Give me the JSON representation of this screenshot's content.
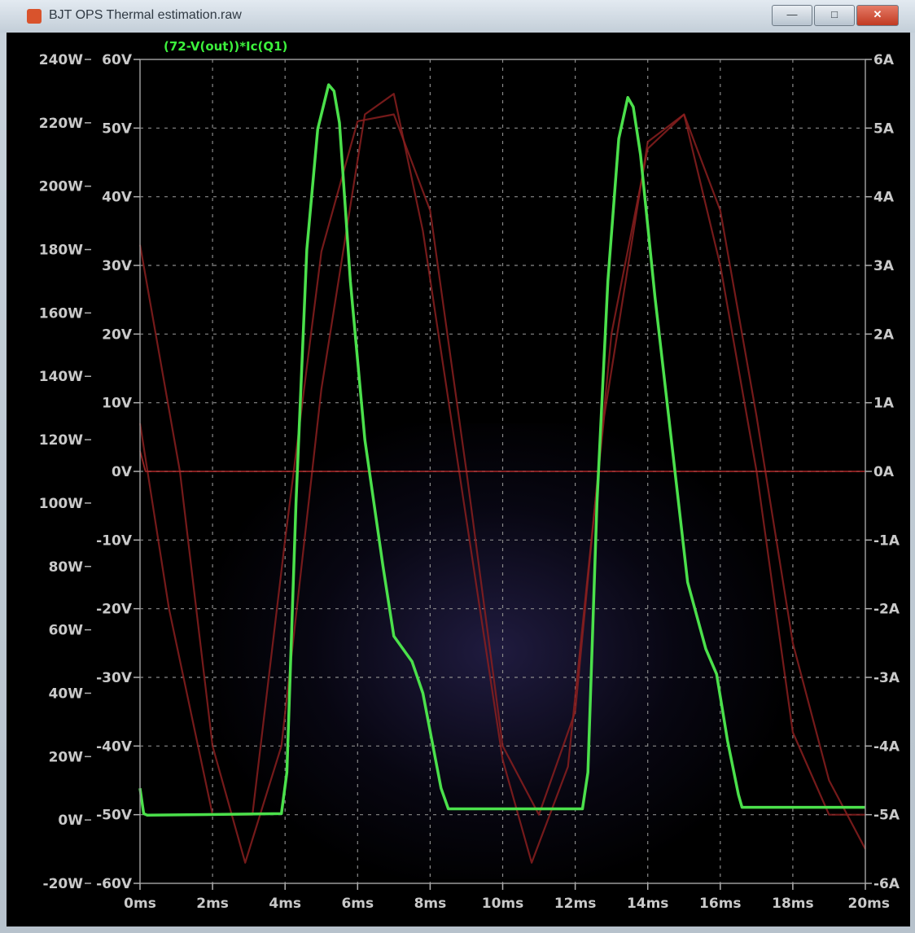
{
  "window": {
    "title": "BJT OPS Thermal estimation.raw",
    "minimize_label": "—",
    "maximize_label": "□",
    "close_label": "✕"
  },
  "chart_data": {
    "type": "line",
    "title": "(72-V(out))*Ic(Q1)",
    "colors": {
      "power": "#4be04b",
      "waveform": "#8a1e1e",
      "grid": "#8a8a8a",
      "zero_line": "#b02a2a"
    },
    "x_axis": {
      "unit": "ms",
      "range": [
        0,
        20
      ],
      "ticks": [
        0,
        2,
        4,
        6,
        8,
        10,
        12,
        14,
        16,
        18,
        20
      ],
      "tick_labels": [
        "0ms",
        "2ms",
        "4ms",
        "6ms",
        "8ms",
        "10ms",
        "12ms",
        "14ms",
        "16ms",
        "18ms",
        "20ms"
      ]
    },
    "y_axis_power": {
      "range": [
        -20,
        240
      ],
      "ticks": [
        -20,
        0,
        20,
        40,
        60,
        80,
        100,
        120,
        140,
        160,
        180,
        200,
        220,
        240
      ],
      "tick_labels": [
        "-20W",
        "0W",
        "20W",
        "40W",
        "60W",
        "80W",
        "100W",
        "120W",
        "140W",
        "160W",
        "180W",
        "200W",
        "220W",
        "240W"
      ]
    },
    "y_axis_voltage": {
      "range": [
        -60,
        60
      ],
      "ticks": [
        -60,
        -50,
        -40,
        -30,
        -20,
        -10,
        0,
        10,
        20,
        30,
        40,
        50,
        60
      ],
      "tick_labels": [
        "-60V",
        "-50V",
        "-40V",
        "-30V",
        "-20V",
        "-10V",
        "0V",
        "10V",
        "20V",
        "30V",
        "40V",
        "50V",
        "60V"
      ]
    },
    "y_axis_current": {
      "range": [
        -6,
        6
      ],
      "ticks": [
        -6,
        -5,
        -4,
        -3,
        -2,
        -1,
        0,
        1,
        2,
        3,
        4,
        5,
        6
      ],
      "tick_labels": [
        "-6A",
        "-5A",
        "-4A",
        "-3A",
        "-2A",
        "-1A",
        "0A",
        "1A",
        "2A",
        "3A",
        "4A",
        "5A",
        "6A"
      ]
    },
    "grid": true,
    "series": [
      {
        "name": "(72-V(out))*Ic(Q1)",
        "axis": "power",
        "x": [
          0,
          0.1,
          0.2,
          3.9,
          4.05,
          4.3,
          4.6,
          4.9,
          5.2,
          5.35,
          5.5,
          5.8,
          6.2,
          6.7,
          7.0,
          7.5,
          7.8,
          8.0,
          8.3,
          8.5,
          12.2,
          12.35,
          12.6,
          12.9,
          13.2,
          13.45,
          13.6,
          13.8,
          14.2,
          14.7,
          15.1,
          15.6,
          15.9,
          16.2,
          16.5,
          16.6,
          20
        ],
        "y": [
          10,
          2,
          1.5,
          2,
          15,
          100,
          180,
          218,
          232,
          230,
          220,
          170,
          120,
          80,
          58,
          50,
          40,
          28,
          10,
          3.5,
          3.5,
          15,
          100,
          170,
          215,
          228,
          225,
          210,
          165,
          115,
          75,
          54,
          46,
          25,
          8,
          4,
          4
        ]
      },
      {
        "axis": "voltage",
        "x": [
          0,
          1.1,
          2.0,
          2.9,
          3.9,
          5.0,
          6.2,
          7.0,
          7.8,
          8.8,
          10.0,
          10.8,
          11.8,
          12.8,
          14.0,
          15.0,
          16.0,
          17.0,
          18.0,
          19.0,
          20
        ],
        "y": [
          33,
          0,
          -40,
          -57,
          -40,
          12,
          52,
          55,
          35,
          0,
          -42,
          -57,
          -43,
          8,
          48,
          52,
          38,
          8,
          -25,
          -45,
          -55
        ]
      },
      {
        "axis": "voltage",
        "x": [
          0,
          0.8,
          2.0,
          3.1,
          4.0,
          5.0,
          6.0,
          7.0,
          8.0,
          9.0,
          10.0,
          11.0,
          12.0,
          13.0,
          14.0,
          15.0,
          16.0,
          17.0,
          18.0,
          19.0,
          20
        ],
        "y": [
          7,
          -20,
          -50,
          -50,
          -10,
          32,
          51,
          52,
          38,
          0,
          -40,
          -50,
          -35,
          20,
          47,
          52,
          30,
          0,
          -38,
          -50,
          -50
        ]
      },
      {
        "axis": "voltage",
        "x": [
          0,
          0.15,
          0.4,
          20
        ],
        "y": [
          3,
          0,
          0,
          0
        ]
      }
    ]
  }
}
